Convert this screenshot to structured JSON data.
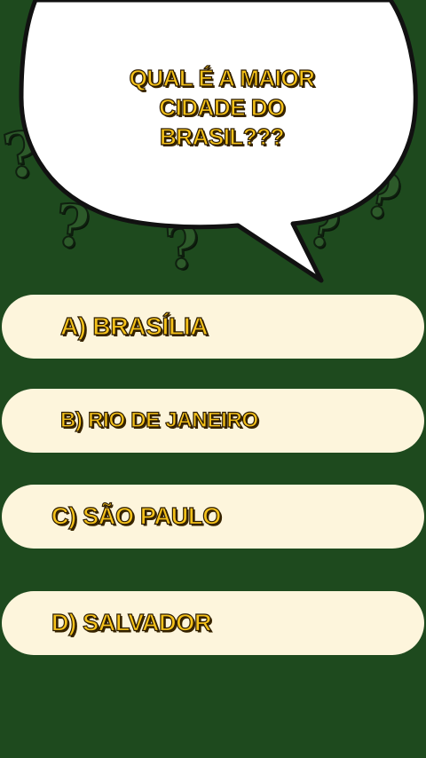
{
  "question": {
    "text": "QUAL É A MAIOR CIDADE DO BRASIL???",
    "line1": "QUAL É A MAIOR",
    "line2": "CIDADE DO",
    "line3": "BRASIL???"
  },
  "options": [
    {
      "letter": "A",
      "label": "A) BRASÍLIA"
    },
    {
      "letter": "B",
      "label": "B) RIO DE JANEIRO"
    },
    {
      "letter": "C",
      "label": "C) SÃO PAULO"
    },
    {
      "letter": "D",
      "label": "D) SALVADOR"
    }
  ],
  "decorations": {
    "question_mark_glyph": "?",
    "icon": "question-mark-icon"
  },
  "colors": {
    "background": "#1e4a1e",
    "bubble": "#ffffff",
    "bubble_outline": "#111111",
    "option_bg": "#fdf5dc",
    "text_fill": "#f5c21a",
    "text_outline": "#2a1a00"
  }
}
